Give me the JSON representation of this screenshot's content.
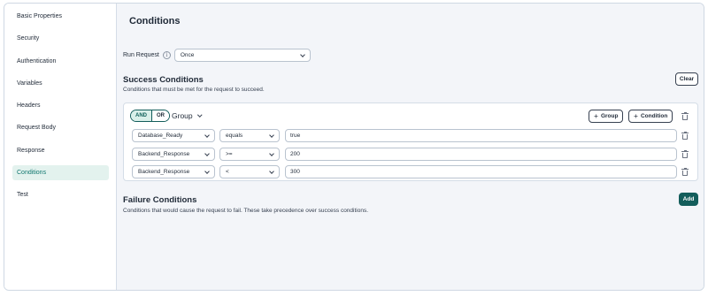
{
  "sidebar": {
    "items": [
      {
        "label": "Basic Properties"
      },
      {
        "label": "Security"
      },
      {
        "label": "Authentication"
      },
      {
        "label": "Variables"
      },
      {
        "label": "Headers"
      },
      {
        "label": "Request Body"
      },
      {
        "label": "Response"
      },
      {
        "label": "Conditions",
        "active": true
      },
      {
        "label": "Test"
      }
    ]
  },
  "main": {
    "title": "Conditions",
    "run_request": {
      "label": "Run Request",
      "info_icon": "i",
      "value": "Once"
    },
    "success": {
      "title": "Success Conditions",
      "description": "Conditions that must be met for the request to succeed.",
      "clear_label": "Clear",
      "operator": {
        "and": "AND",
        "or": "OR",
        "selected": "AND"
      },
      "group_label": "Group",
      "add_group_label": "Group",
      "add_condition_label": "Condition",
      "plus": "+",
      "conditions": [
        {
          "field": "Database_Ready",
          "operator": "equals",
          "value": "true"
        },
        {
          "field": "Backend_Response",
          "operator": ">=",
          "value": "200"
        },
        {
          "field": "Backend_Response",
          "operator": "<",
          "value": "300"
        }
      ]
    },
    "failure": {
      "title": "Failure Conditions",
      "description": "Conditions that would cause the request to fail. These take precedence over success conditions.",
      "add_label": "Add"
    }
  },
  "colors": {
    "accent": "#135d5b",
    "active_bg": "#e3f2ee",
    "panel_bg": "#f3f5f9"
  }
}
